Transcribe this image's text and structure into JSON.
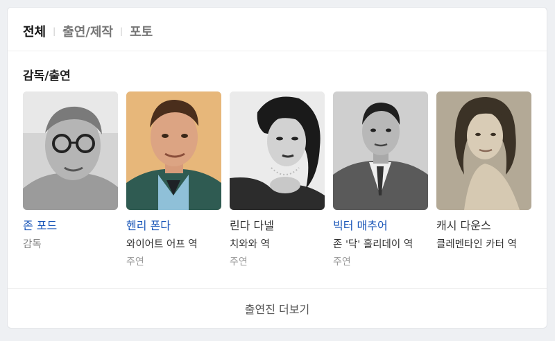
{
  "tabs": [
    {
      "label": "전체"
    },
    {
      "label": "출연/제작"
    },
    {
      "label": "포토"
    }
  ],
  "section_title": "감독/출연",
  "people": [
    {
      "name": "존 포드",
      "role": "감독",
      "credit": ""
    },
    {
      "name": "헨리 폰다",
      "role": "와이어트 어프 역",
      "credit": "주연"
    },
    {
      "name": "린다 다넬",
      "role": "치와와 역",
      "credit": "주연"
    },
    {
      "name": "빅터 매추어",
      "role": "존 '닥' 홀리데이 역",
      "credit": "주연"
    },
    {
      "name": "캐시 다운스",
      "role": "클레멘타인 카터 역",
      "credit": ""
    }
  ],
  "more_label": "출연진 더보기",
  "colors": {
    "link": "#1a56b8",
    "muted": "#888888",
    "background": "#eef0f3",
    "card": "#ffffff"
  }
}
